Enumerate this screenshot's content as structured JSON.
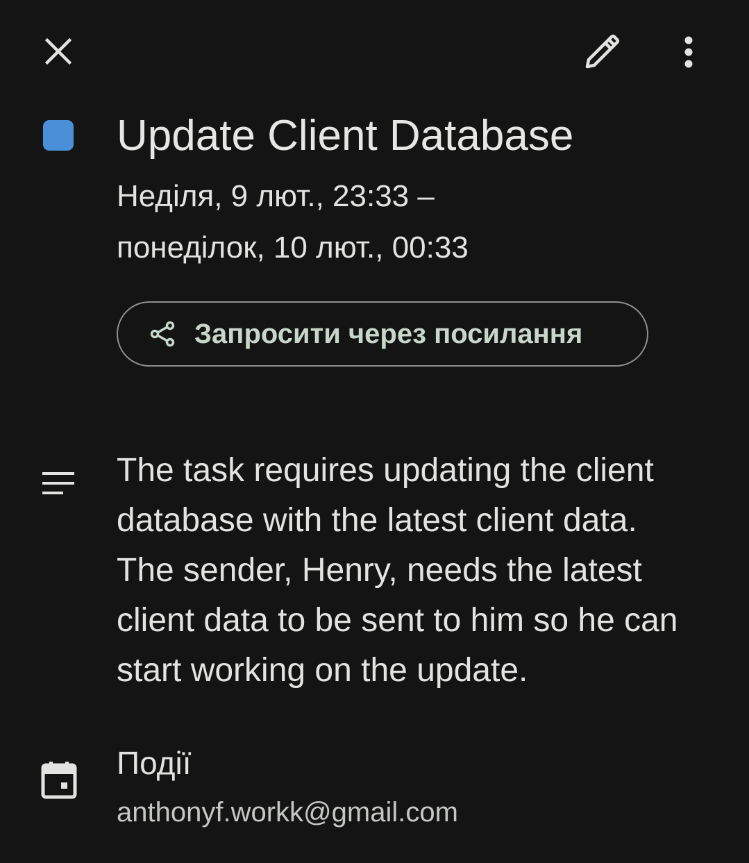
{
  "toolbar": {
    "close_icon": "close-icon",
    "edit_icon": "pencil-icon",
    "more_icon": "more-vertical-icon"
  },
  "event": {
    "color": "#4a90d9",
    "title": "Update Client Database",
    "date_start": "Неділя, 9 лют., 23:33 –",
    "date_end": "понеділок, 10 лют., 00:33"
  },
  "invite": {
    "icon": "share-icon",
    "label": "Запросити через посилання"
  },
  "description": {
    "icon": "notes-icon",
    "lines": [
      "The task requires updating the client",
      "database with the latest client data.",
      "The sender, Henry, needs the latest",
      "client data to be sent to him so he can",
      "start working on the update."
    ]
  },
  "calendar": {
    "icon": "calendar-icon",
    "name": "Події",
    "account": "anthonyf.workk@gmail.com"
  }
}
